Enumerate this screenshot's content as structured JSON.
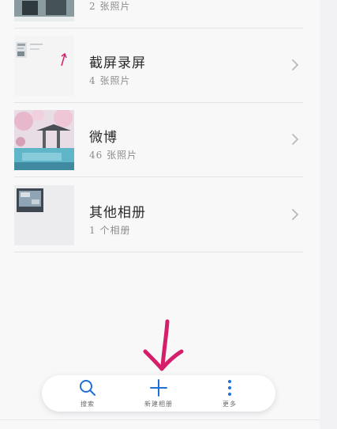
{
  "albums": [
    {
      "title": "",
      "count": "2 张照片"
    },
    {
      "title": "截屏录屏",
      "count": "4 张照片"
    },
    {
      "title": "微博",
      "count": "46 张照片"
    },
    {
      "title": "其他相册",
      "count": "1 个相册"
    }
  ],
  "bottom_bar": {
    "search_label": "搜索",
    "new_album_label": "新建相册",
    "more_label": "更多"
  },
  "icons": {
    "search": "search-icon",
    "add": "plus-icon",
    "more": "more-vertical-icon",
    "chevron": "chevron-right-icon"
  },
  "colors": {
    "accent": "#1f6fd6",
    "annotation": "#d61f6b",
    "title_text": "#2a2a2a",
    "sub_text": "#8c8c8c"
  }
}
